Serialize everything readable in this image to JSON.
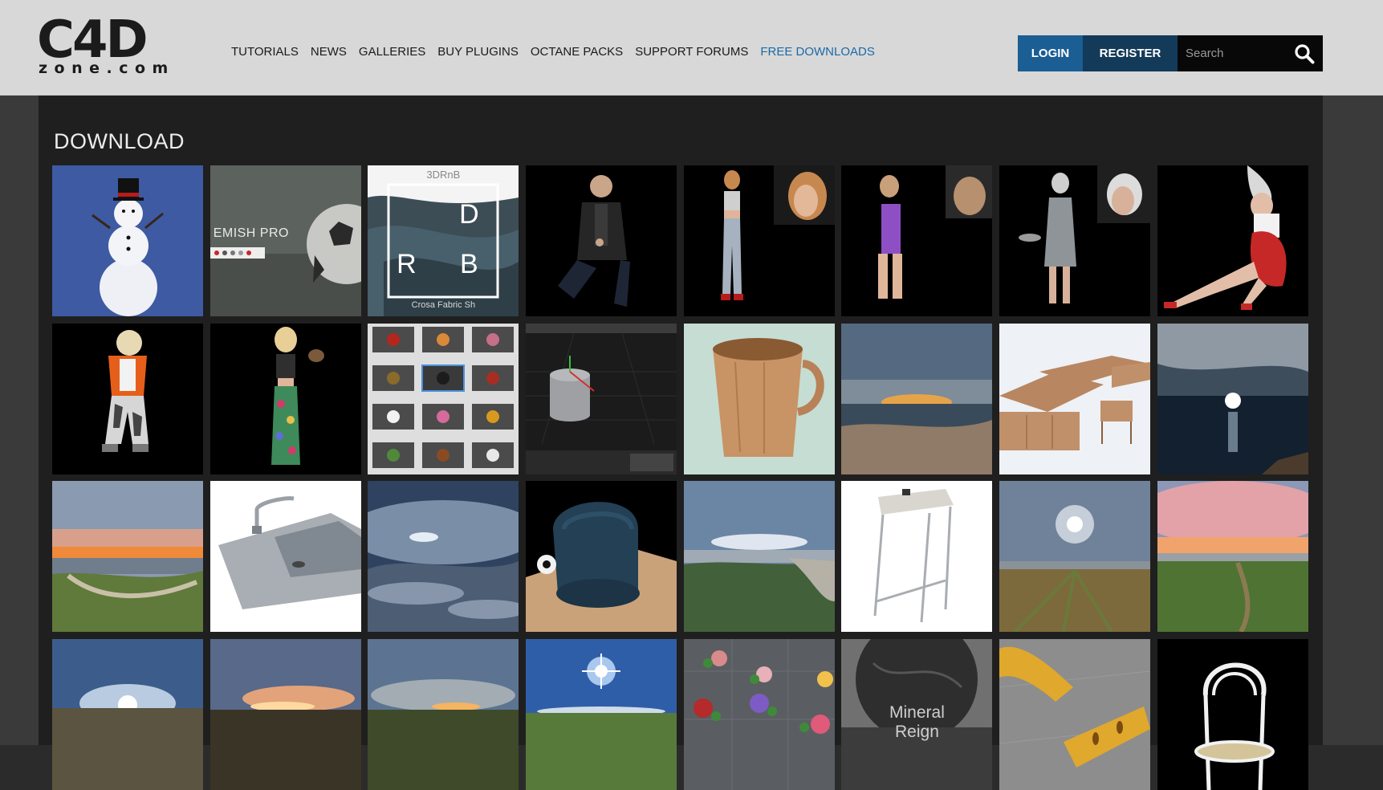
{
  "logo": {
    "mark": "C4D",
    "sub": "zone.com"
  },
  "nav": [
    {
      "label": "TUTORIALS"
    },
    {
      "label": "NEWS"
    },
    {
      "label": "GALLERIES"
    },
    {
      "label": "BUY PLUGINS"
    },
    {
      "label": "OCTANE PACKS"
    },
    {
      "label": "SUPPORT FORUMS"
    },
    {
      "label": "FREE DOWNLOADS",
      "active": true
    }
  ],
  "auth": {
    "login_label": "LOGIN",
    "register_label": "REGISTER"
  },
  "search": {
    "placeholder": "Search",
    "icon": "search-icon"
  },
  "colors": {
    "header_bg": "#d8d8d8",
    "nav_active": "#1a6aa8",
    "login_bg": "#1a5e94",
    "register_bg": "#143a5a",
    "panel_bg": "#1f1f1f"
  },
  "main": {
    "title": "DOWNLOAD",
    "tiles": [
      {
        "name": "snowman-thumbnail"
      },
      {
        "name": "soccer-ball-thumbnail",
        "text": "EMISH PRO"
      },
      {
        "name": "fabric-thumbnail",
        "text": "3DRnB",
        "letters": [
          "D",
          "R",
          "B"
        ],
        "caption": "Crosa Fabric Sh"
      },
      {
        "name": "sitting-man-thumbnail"
      },
      {
        "name": "woman-jeans-thumbnail"
      },
      {
        "name": "girl-purple-thumbnail"
      },
      {
        "name": "old-woman-thumbnail"
      },
      {
        "name": "woman-red-skirt-thumbnail"
      },
      {
        "name": "woman-orange-jacket-thumbnail"
      },
      {
        "name": "woman-floral-dress-thumbnail"
      },
      {
        "name": "asset-collection-thumbnail"
      },
      {
        "name": "c4d-viewport-cylinder-thumbnail"
      },
      {
        "name": "wooden-mug-thumbnail"
      },
      {
        "name": "sunset-beach-hdri-thumbnail"
      },
      {
        "name": "wooden-furniture-thumbnail"
      },
      {
        "name": "sun-over-sea-hdri-thumbnail"
      },
      {
        "name": "sunset-shore-hdri-thumbnail"
      },
      {
        "name": "kitchen-sink-thumbnail"
      },
      {
        "name": "above-clouds-hdri-thumbnail"
      },
      {
        "name": "blue-armchair-thumbnail"
      },
      {
        "name": "sea-coast-hdri-thumbnail"
      },
      {
        "name": "bar-stool-thumbnail"
      },
      {
        "name": "sunny-field-hdri-thumbnail"
      },
      {
        "name": "pink-sunset-meadow-hdri-thumbnail"
      },
      {
        "name": "sunrise-field-hdri-thumbnail"
      },
      {
        "name": "dusk-field-hdri-thumbnail"
      },
      {
        "name": "evening-field-hdri-thumbnail"
      },
      {
        "name": "bright-sun-field-hdri-thumbnail"
      },
      {
        "name": "flowers-thumbnail"
      },
      {
        "name": "mineral-sphere-thumbnail",
        "text": "Mineral",
        "text2": "Reign"
      },
      {
        "name": "yellow-shapes-thumbnail"
      },
      {
        "name": "bentwood-chair-thumbnail"
      }
    ]
  }
}
